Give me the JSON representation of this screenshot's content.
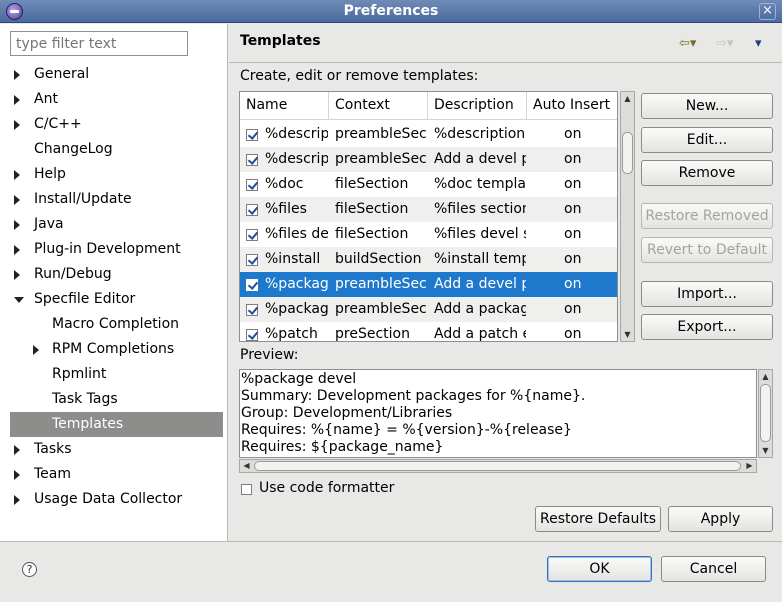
{
  "window": {
    "title": "Preferences",
    "close_glyph": "×"
  },
  "sidebar": {
    "filter_placeholder": "type filter text",
    "items": [
      {
        "label": "General",
        "arrow": "right"
      },
      {
        "label": "Ant",
        "arrow": "right"
      },
      {
        "label": "C/C++",
        "arrow": "right"
      },
      {
        "label": "ChangeLog",
        "arrow": "none"
      },
      {
        "label": "Help",
        "arrow": "right"
      },
      {
        "label": "Install/Update",
        "arrow": "right"
      },
      {
        "label": "Java",
        "arrow": "right"
      },
      {
        "label": "Plug-in Development",
        "arrow": "right"
      },
      {
        "label": "Run/Debug",
        "arrow": "right"
      },
      {
        "label": "Specfile Editor",
        "arrow": "down"
      },
      {
        "label": "Macro Completion",
        "arrow": "none"
      },
      {
        "label": "RPM Completions",
        "arrow": "right"
      },
      {
        "label": "Rpmlint",
        "arrow": "none"
      },
      {
        "label": "Task Tags",
        "arrow": "none"
      },
      {
        "label": "Templates",
        "arrow": "none",
        "selected": true
      },
      {
        "label": "Tasks",
        "arrow": "right"
      },
      {
        "label": "Team",
        "arrow": "right"
      },
      {
        "label": "Usage Data Collector",
        "arrow": "right"
      }
    ]
  },
  "page": {
    "title": "Templates",
    "description": "Create, edit or remove templates:",
    "nav_back": "⇦▾",
    "nav_forward": "⇨▾",
    "nav_menu": "▾"
  },
  "table": {
    "columns": [
      "Name",
      "Context",
      "Description",
      "Auto Insert"
    ],
    "rows": [
      {
        "name": "%descripti",
        "context": "preambleSection",
        "description": "%description",
        "auto": "on"
      },
      {
        "name": "%descripti",
        "context": "preambleSection",
        "description": "Add a devel package",
        "auto": "on"
      },
      {
        "name": "%doc",
        "context": "fileSection",
        "description": "%doc template",
        "auto": "on"
      },
      {
        "name": "%files",
        "context": "fileSection",
        "description": "%files section",
        "auto": "on"
      },
      {
        "name": "%files dev",
        "context": "fileSection",
        "description": "%files devel section",
        "auto": "on"
      },
      {
        "name": "%install",
        "context": "buildSection",
        "description": "%install template",
        "auto": "on"
      },
      {
        "name": "%package",
        "context": "preambleSection",
        "description": "Add a devel package",
        "auto": "on",
        "selected": true
      },
      {
        "name": "%package",
        "context": "preambleSection",
        "description": "Add a package",
        "auto": "on"
      },
      {
        "name": "%patch",
        "context": "preSection",
        "description": "Add a patch entry",
        "auto": "on"
      }
    ]
  },
  "buttons": {
    "new": "New...",
    "edit": "Edit...",
    "remove": "Remove",
    "restore_removed": "Restore Removed",
    "revert_default": "Revert to Default",
    "import": "Import...",
    "export": "Export...",
    "restore_defaults": "Restore Defaults",
    "apply": "Apply",
    "ok": "OK",
    "cancel": "Cancel"
  },
  "preview": {
    "label": "Preview:",
    "text": "%package devel\nSummary: Development packages for %{name}.\nGroup: Development/Libraries\nRequires: %{name} = %{version}-%{release}\nRequires: ${package_name}"
  },
  "use_formatter": {
    "label": "Use code formatter",
    "checked": false
  },
  "help_glyph": "?"
}
